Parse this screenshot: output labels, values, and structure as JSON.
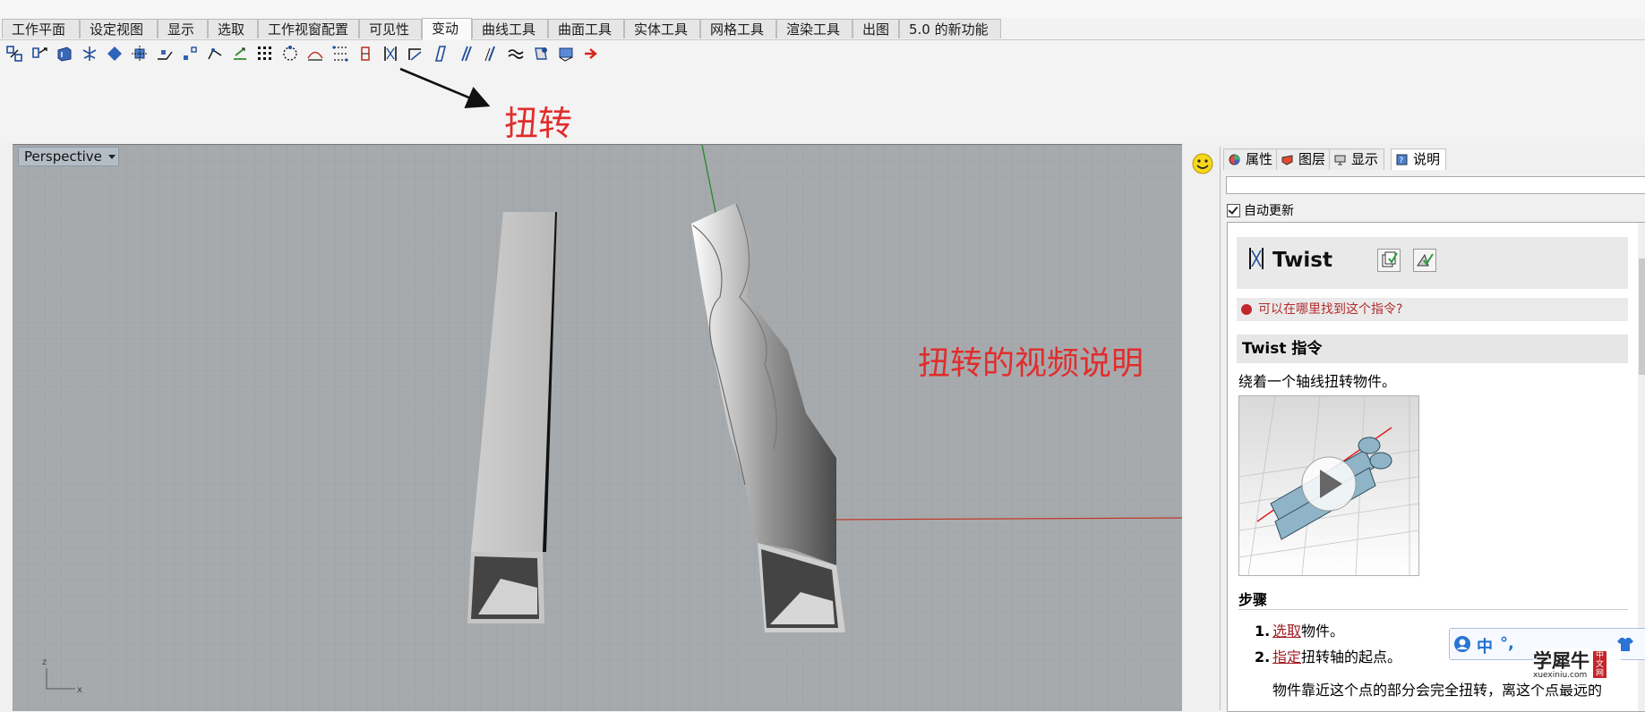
{
  "menu_tabs": [
    {
      "label": "工作平面"
    },
    {
      "label": "设定视图"
    },
    {
      "label": "显示"
    },
    {
      "label": "选取"
    },
    {
      "label": "工作视窗配置"
    },
    {
      "label": "可见性"
    },
    {
      "label": "变动",
      "active": true
    },
    {
      "label": "曲线工具"
    },
    {
      "label": "曲面工具"
    },
    {
      "label": "实体工具"
    },
    {
      "label": "网格工具"
    },
    {
      "label": "渲染工具"
    },
    {
      "label": "出图"
    },
    {
      "label": "5.0 的新功能"
    }
  ],
  "toolbar": {
    "icons": [
      "move-icon",
      "copy-icon",
      "rotate-icon",
      "scale-icon",
      "mirror-icon",
      "array-icon",
      "orient-icon",
      "align-icon",
      "set-points-icon",
      "project-icon",
      "flow-icon",
      "bend-icon",
      "grid-array-icon",
      "polar-array-icon",
      "control-points-icon",
      "cage-edit-icon",
      "twist-icon",
      "taper-icon",
      "shear-icon",
      "smash-icon",
      "stretch-icon",
      "squish-icon",
      "splop-icon",
      "flow-surface-icon",
      "record-history-icon",
      "export-icon"
    ]
  },
  "annotations": {
    "twist_label": "扭转",
    "video_label": "扭转的视频说明"
  },
  "viewport": {
    "name": "Perspective",
    "colors": {
      "background": "#a7aaad",
      "x_axis": "#c0392b",
      "y_axis": "#2e8b2e"
    }
  },
  "panel": {
    "tabs": [
      {
        "label": "属性",
        "icon": "properties-icon"
      },
      {
        "label": "图层",
        "icon": "layers-icon"
      },
      {
        "label": "显示",
        "icon": "display-icon"
      },
      {
        "label": "说明",
        "icon": "help-icon",
        "active": true
      }
    ],
    "auto_update_label": "自动更新",
    "help": {
      "title": "Twist",
      "where_link": "可以在哪里找到这个指令?",
      "command_heading": "Twist 指令",
      "description": "绕着一个轴线扭转物件。",
      "steps_heading": "步骤",
      "steps": [
        {
          "num": "1.",
          "link": "选取",
          "text": "物件。"
        },
        {
          "num": "2.",
          "link": "指定",
          "text": "扭转轴的起点。"
        }
      ],
      "note": "物件靠近这个点的部分会完全扭转，离这个点最远的"
    }
  },
  "ime_bar": {
    "lang": "中",
    "punct": "°,"
  },
  "watermark": {
    "cn": "学犀牛",
    "en": "xuexiniu.com",
    "badge": "中文网"
  }
}
